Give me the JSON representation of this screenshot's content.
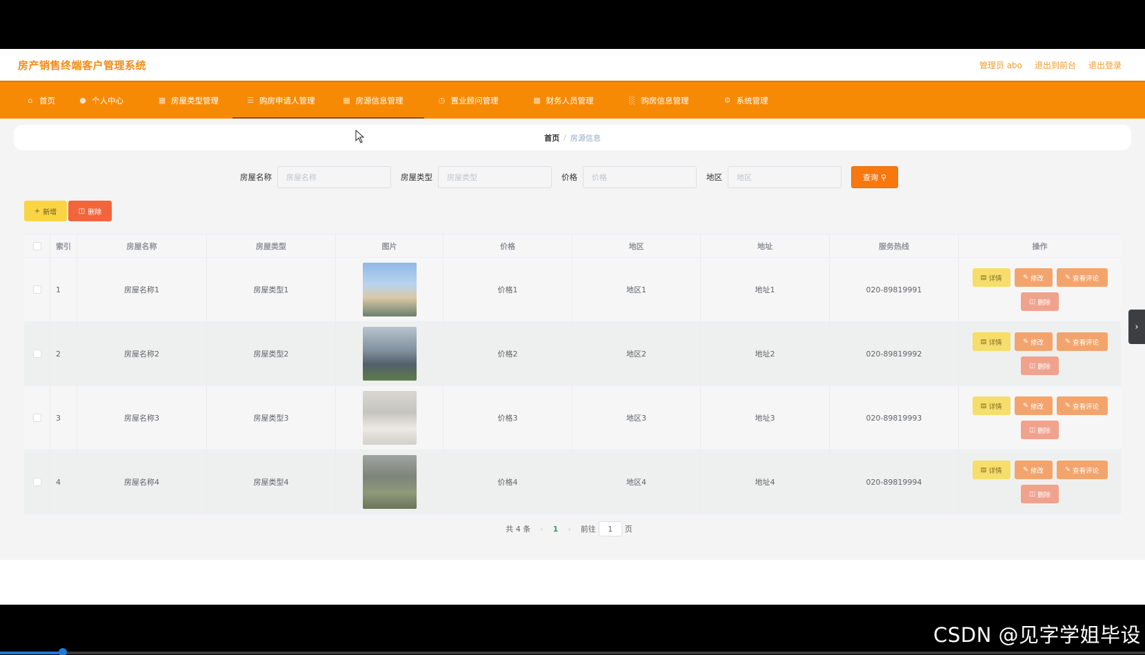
{
  "header": {
    "title": "房产销售终端客户管理系统",
    "links": [
      "管理员 abo",
      "退出到前台",
      "退出登录"
    ]
  },
  "nav": {
    "items": [
      {
        "label": "首页",
        "icon": "home-icon"
      },
      {
        "label": "个人中心",
        "icon": "user-icon"
      },
      {
        "label": "房屋类型管理",
        "icon": "building-icon"
      },
      {
        "label": "购房申请人管理",
        "icon": "list-icon"
      },
      {
        "label": "房源信息管理",
        "icon": "building-icon"
      },
      {
        "label": "置业顾问管理",
        "icon": "clock-icon"
      },
      {
        "label": "财务人员管理",
        "icon": "chat-icon"
      },
      {
        "label": "购房信息管理",
        "icon": "chart-icon"
      },
      {
        "label": "系统管理",
        "icon": "settings-icon"
      }
    ]
  },
  "breadcrumb": {
    "home": "首页",
    "separator": "/",
    "current": "房源信息"
  },
  "search": {
    "name_label": "房屋名称",
    "name_placeholder": "房屋名称",
    "type_label": "房屋类型",
    "type_placeholder": "房屋类型",
    "price_label": "价格",
    "price_placeholder": "价格",
    "area_label": "地区",
    "area_placeholder": "地区",
    "query_button": "查询"
  },
  "actions": {
    "add": "新增",
    "delete": "删除"
  },
  "table": {
    "headers": [
      "索引",
      "房屋名称",
      "房屋类型",
      "图片",
      "价格",
      "地区",
      "地址",
      "服务热线",
      "操作"
    ],
    "rows": [
      {
        "index": "1",
        "name": "房屋名称1",
        "type": "房屋类型1",
        "price": "价格1",
        "area": "地区1",
        "address": "地址1",
        "phone": "020-89819991"
      },
      {
        "index": "2",
        "name": "房屋名称2",
        "type": "房屋类型2",
        "price": "价格2",
        "area": "地区2",
        "address": "地址2",
        "phone": "020-89819992"
      },
      {
        "index": "3",
        "name": "房屋名称3",
        "type": "房屋类型3",
        "price": "价格3",
        "area": "地区3",
        "address": "地址3",
        "phone": "020-89819993"
      },
      {
        "index": "4",
        "name": "房屋名称4",
        "type": "房屋类型4",
        "price": "价格4",
        "area": "地区4",
        "address": "地址4",
        "phone": "020-89819994"
      }
    ],
    "ops": {
      "detail": "详情",
      "edit": "修改",
      "review": "查看评论",
      "delete": "删除"
    }
  },
  "pagination": {
    "total": "共 4 条",
    "current": "1",
    "goto_prefix": "前往",
    "goto_value": "1",
    "goto_suffix": "页"
  },
  "watermark": "CSDN @见字学姐毕设",
  "colors": {
    "accent": "#f78a05",
    "title": "#f48b15",
    "query": "#f7780f",
    "add": "#f9d545",
    "delete": "#f1653b"
  }
}
